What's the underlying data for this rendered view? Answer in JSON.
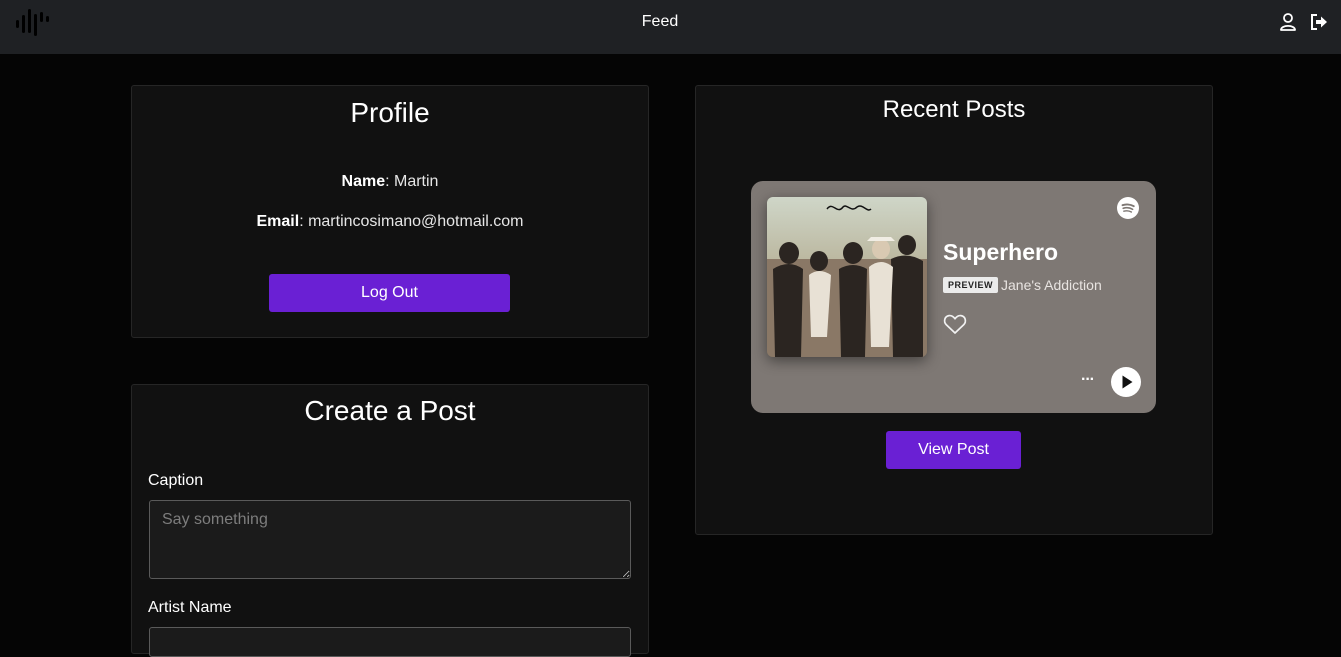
{
  "nav": {
    "title": "Feed",
    "logo_icon": "soundwave-logo-icon",
    "profile_icon": "user-icon",
    "logout_icon": "sign-out-icon"
  },
  "profile": {
    "title": "Profile",
    "name_label": "Name",
    "name_value": ": Martin",
    "email_label": "Email",
    "email_value": ": martincosimano@hotmail.com",
    "logout_label": "Log Out"
  },
  "create_post": {
    "title": "Create a Post",
    "caption_label": "Caption",
    "caption_placeholder": "Say something",
    "caption_value": "",
    "artist_label": "Artist Name",
    "artist_value": ""
  },
  "recent_posts": {
    "title": "Recent Posts",
    "embed": {
      "track": "Superhero",
      "badge": "PREVIEW",
      "artist": "Jane's Addiction",
      "more_label": "···",
      "brand_icon": "spotify-icon",
      "like_icon": "heart-icon",
      "play_icon": "play-icon"
    },
    "view_post_label": "View Post"
  },
  "colors": {
    "accent": "#6a20d4",
    "navbar": "#1f2124",
    "card": "#111111",
    "page": "#050505",
    "embed_bg": "#7e7874"
  }
}
